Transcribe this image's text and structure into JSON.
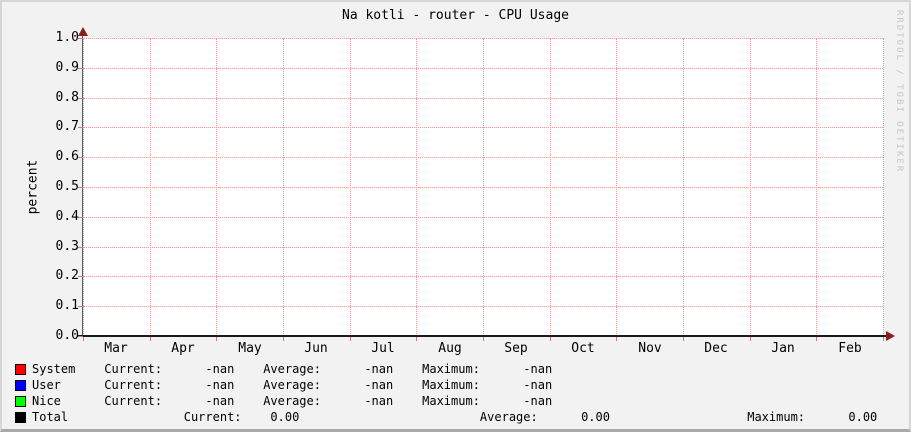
{
  "title": "Na kotli - router - CPU Usage",
  "watermark": "RRDTOOL / TOBI OETIKER",
  "colors": {
    "background": "#f2f2f2",
    "plot_background": "#ffffff",
    "grid": "#eb9999",
    "tick": "#cc7a7a",
    "axis": "#1a1a1a",
    "arrow": "#8b1f1f",
    "watermark_text": "#c6c6c6",
    "system": "#ff0000",
    "user": "#0000ff",
    "nice": "#00ff00",
    "total": "#000000"
  },
  "chart_data": {
    "type": "line",
    "title": "Na kotli - router - CPU Usage",
    "xlabel": "",
    "ylabel": "percent",
    "ylim": [
      0.0,
      1.0
    ],
    "ytick_step": 0.1,
    "ytick_labels": [
      "1.0",
      "0.9",
      "0.8",
      "0.7",
      "0.6",
      "0.5",
      "0.4",
      "0.3",
      "0.2",
      "0.1",
      "0.0"
    ],
    "x_categories": [
      "Mar",
      "Apr",
      "May",
      "Jun",
      "Jul",
      "Aug",
      "Sep",
      "Oct",
      "Nov",
      "Dec",
      "Jan",
      "Feb"
    ],
    "grid": true,
    "legend_position": "bottom",
    "series": [
      {
        "name": "System",
        "color": "#ff0000",
        "values": null,
        "current": "-nan",
        "average": "-nan",
        "maximum": "-nan"
      },
      {
        "name": "User",
        "color": "#0000ff",
        "values": null,
        "current": "-nan",
        "average": "-nan",
        "maximum": "-nan"
      },
      {
        "name": "Nice",
        "color": "#00ff00",
        "values": null,
        "current": "-nan",
        "average": "-nan",
        "maximum": "-nan"
      },
      {
        "name": "Total",
        "color": "#000000",
        "values": 0.0,
        "current": "0.00",
        "average": "0.00",
        "maximum": "0.00"
      }
    ]
  },
  "legend": {
    "rows": [
      {
        "name": "System",
        "color": "#ff0000",
        "text": "System    Current:      -nan    Average:      -nan    Maximum:      -nan"
      },
      {
        "name": "User",
        "color": "#0000ff",
        "text": "User      Current:      -nan    Average:      -nan    Maximum:      -nan"
      },
      {
        "name": "Nice",
        "color": "#00ff00",
        "text": "Nice      Current:      -nan    Average:      -nan    Maximum:      -nan"
      },
      {
        "name": "Total",
        "color": "#000000",
        "text": "Total                Current:    0.00                         Average:      0.00                   Maximum:      0.00"
      }
    ]
  }
}
